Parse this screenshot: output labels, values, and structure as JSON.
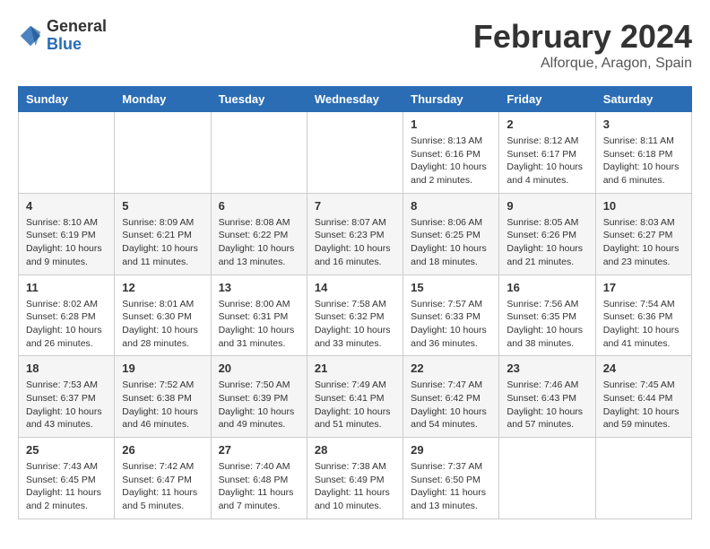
{
  "header": {
    "logo_general": "General",
    "logo_blue": "Blue",
    "title": "February 2024",
    "subtitle": "Alforque, Aragon, Spain"
  },
  "calendar": {
    "columns": [
      "Sunday",
      "Monday",
      "Tuesday",
      "Wednesday",
      "Thursday",
      "Friday",
      "Saturday"
    ],
    "rows": [
      [
        {
          "day": "",
          "info": ""
        },
        {
          "day": "",
          "info": ""
        },
        {
          "day": "",
          "info": ""
        },
        {
          "day": "",
          "info": ""
        },
        {
          "day": "1",
          "info": "Sunrise: 8:13 AM\nSunset: 6:16 PM\nDaylight: 10 hours\nand 2 minutes."
        },
        {
          "day": "2",
          "info": "Sunrise: 8:12 AM\nSunset: 6:17 PM\nDaylight: 10 hours\nand 4 minutes."
        },
        {
          "day": "3",
          "info": "Sunrise: 8:11 AM\nSunset: 6:18 PM\nDaylight: 10 hours\nand 6 minutes."
        }
      ],
      [
        {
          "day": "4",
          "info": "Sunrise: 8:10 AM\nSunset: 6:19 PM\nDaylight: 10 hours\nand 9 minutes."
        },
        {
          "day": "5",
          "info": "Sunrise: 8:09 AM\nSunset: 6:21 PM\nDaylight: 10 hours\nand 11 minutes."
        },
        {
          "day": "6",
          "info": "Sunrise: 8:08 AM\nSunset: 6:22 PM\nDaylight: 10 hours\nand 13 minutes."
        },
        {
          "day": "7",
          "info": "Sunrise: 8:07 AM\nSunset: 6:23 PM\nDaylight: 10 hours\nand 16 minutes."
        },
        {
          "day": "8",
          "info": "Sunrise: 8:06 AM\nSunset: 6:25 PM\nDaylight: 10 hours\nand 18 minutes."
        },
        {
          "day": "9",
          "info": "Sunrise: 8:05 AM\nSunset: 6:26 PM\nDaylight: 10 hours\nand 21 minutes."
        },
        {
          "day": "10",
          "info": "Sunrise: 8:03 AM\nSunset: 6:27 PM\nDaylight: 10 hours\nand 23 minutes."
        }
      ],
      [
        {
          "day": "11",
          "info": "Sunrise: 8:02 AM\nSunset: 6:28 PM\nDaylight: 10 hours\nand 26 minutes."
        },
        {
          "day": "12",
          "info": "Sunrise: 8:01 AM\nSunset: 6:30 PM\nDaylight: 10 hours\nand 28 minutes."
        },
        {
          "day": "13",
          "info": "Sunrise: 8:00 AM\nSunset: 6:31 PM\nDaylight: 10 hours\nand 31 minutes."
        },
        {
          "day": "14",
          "info": "Sunrise: 7:58 AM\nSunset: 6:32 PM\nDaylight: 10 hours\nand 33 minutes."
        },
        {
          "day": "15",
          "info": "Sunrise: 7:57 AM\nSunset: 6:33 PM\nDaylight: 10 hours\nand 36 minutes."
        },
        {
          "day": "16",
          "info": "Sunrise: 7:56 AM\nSunset: 6:35 PM\nDaylight: 10 hours\nand 38 minutes."
        },
        {
          "day": "17",
          "info": "Sunrise: 7:54 AM\nSunset: 6:36 PM\nDaylight: 10 hours\nand 41 minutes."
        }
      ],
      [
        {
          "day": "18",
          "info": "Sunrise: 7:53 AM\nSunset: 6:37 PM\nDaylight: 10 hours\nand 43 minutes."
        },
        {
          "day": "19",
          "info": "Sunrise: 7:52 AM\nSunset: 6:38 PM\nDaylight: 10 hours\nand 46 minutes."
        },
        {
          "day": "20",
          "info": "Sunrise: 7:50 AM\nSunset: 6:39 PM\nDaylight: 10 hours\nand 49 minutes."
        },
        {
          "day": "21",
          "info": "Sunrise: 7:49 AM\nSunset: 6:41 PM\nDaylight: 10 hours\nand 51 minutes."
        },
        {
          "day": "22",
          "info": "Sunrise: 7:47 AM\nSunset: 6:42 PM\nDaylight: 10 hours\nand 54 minutes."
        },
        {
          "day": "23",
          "info": "Sunrise: 7:46 AM\nSunset: 6:43 PM\nDaylight: 10 hours\nand 57 minutes."
        },
        {
          "day": "24",
          "info": "Sunrise: 7:45 AM\nSunset: 6:44 PM\nDaylight: 10 hours\nand 59 minutes."
        }
      ],
      [
        {
          "day": "25",
          "info": "Sunrise: 7:43 AM\nSunset: 6:45 PM\nDaylight: 11 hours\nand 2 minutes."
        },
        {
          "day": "26",
          "info": "Sunrise: 7:42 AM\nSunset: 6:47 PM\nDaylight: 11 hours\nand 5 minutes."
        },
        {
          "day": "27",
          "info": "Sunrise: 7:40 AM\nSunset: 6:48 PM\nDaylight: 11 hours\nand 7 minutes."
        },
        {
          "day": "28",
          "info": "Sunrise: 7:38 AM\nSunset: 6:49 PM\nDaylight: 11 hours\nand 10 minutes."
        },
        {
          "day": "29",
          "info": "Sunrise: 7:37 AM\nSunset: 6:50 PM\nDaylight: 11 hours\nand 13 minutes."
        },
        {
          "day": "",
          "info": ""
        },
        {
          "day": "",
          "info": ""
        }
      ]
    ]
  }
}
